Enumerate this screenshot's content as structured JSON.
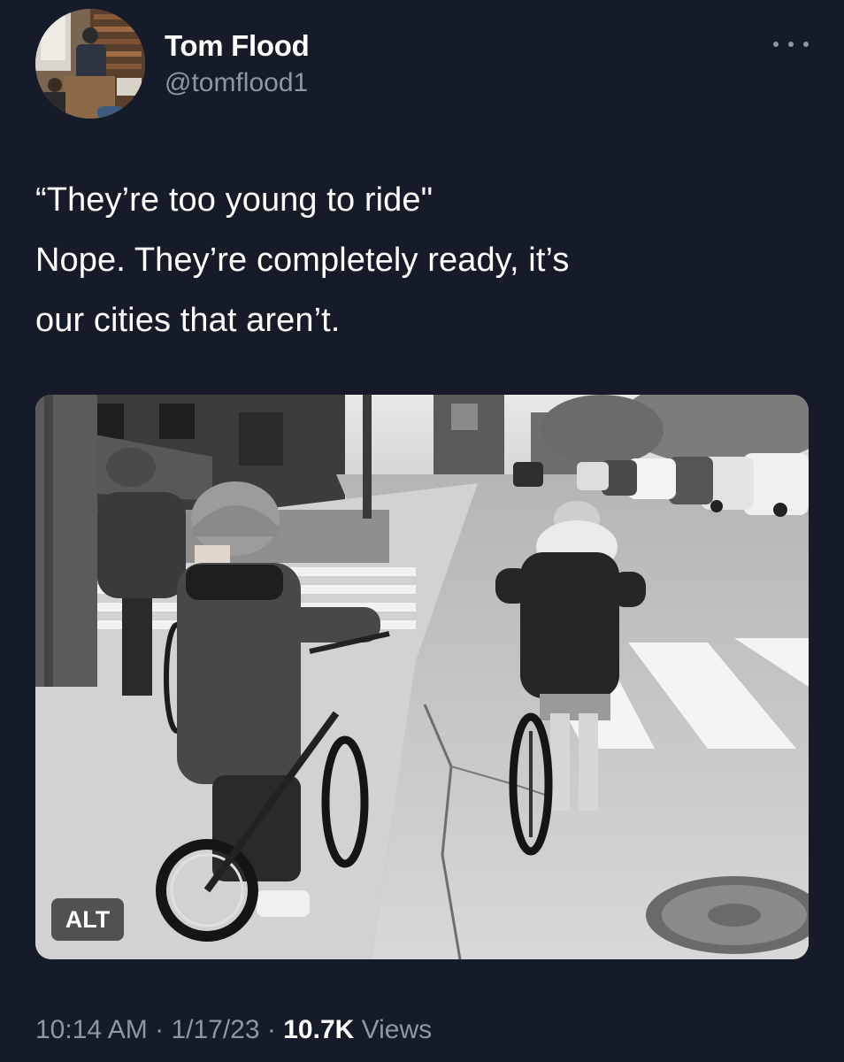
{
  "author": {
    "display_name": "Tom Flood",
    "handle": "@tomflood1",
    "avatar_icon": "profile-photo-avatar"
  },
  "menu": {
    "icon": "more-options-icon"
  },
  "tweet": {
    "text": "“They’re too young to ride\"\nNope. They’re completely ready, it’s\nour cities that aren’t."
  },
  "media": {
    "alt_label": "ALT",
    "photo_subject": "black-and-white photo of three children on bicycles at a street corner crosswalk"
  },
  "meta": {
    "time": "10:14 AM",
    "separator": "·",
    "date": "1/17/23",
    "views_count": "10.7K",
    "views_label": "Views"
  },
  "colors": {
    "background": "#151b28",
    "text_primary": "#ffffff",
    "text_secondary": "#8b98a5"
  }
}
